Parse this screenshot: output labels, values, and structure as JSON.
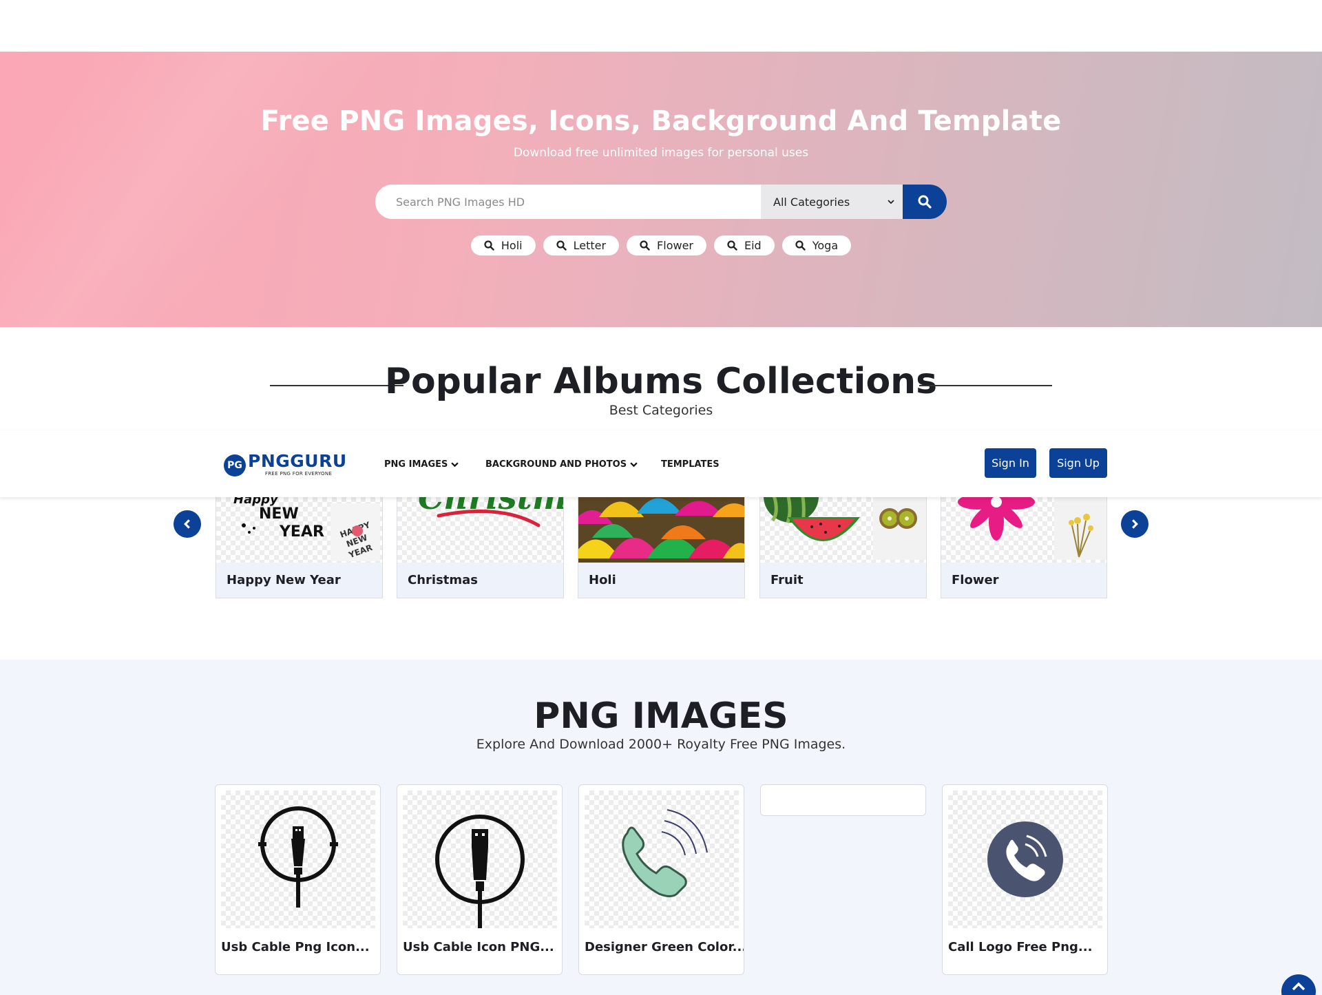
{
  "hero": {
    "title": "Free PNG Images, Icons, Background And Template",
    "subtitle": "Download free unlimited images for personal uses",
    "search_placeholder": "Search PNG Images HD",
    "category_selected": "All Categories",
    "tags": [
      "Holi",
      "Letter",
      "Flower",
      "Eid",
      "Yoga"
    ]
  },
  "albums": {
    "title": "Popular Albums Collections",
    "subtitle": "Best Categories",
    "items": [
      "Happy New Year",
      "Christmas",
      "Holi",
      "Fruit",
      "Flower"
    ]
  },
  "nav": {
    "logo_text": "PNGGURU",
    "logo_mark": "PG",
    "logo_tagline": "FREE PNG FOR EVERYONE",
    "items": [
      "PNG IMAGES",
      "BACKGROUND AND PHOTOS",
      "TEMPLATES"
    ],
    "sign_in": "Sign In",
    "sign_up": "Sign Up"
  },
  "png_section": {
    "title": "PNG IMAGES",
    "subtitle": "Explore And Download 2000+ Royalty Free PNG Images.",
    "cards": [
      "Usb Cable Png Icon...",
      "Usb Cable Icon PNG...",
      "Designer Green Color...",
      "",
      "Call Logo Free Png..."
    ]
  },
  "colors": {
    "brand_blue": "#0b4197",
    "card_label_bg": "#eef2fb",
    "section_bg": "#f2f6fc"
  },
  "icons": [
    "search-icon",
    "chevron-down-icon",
    "chevron-left-icon",
    "chevron-right-icon",
    "chevron-up-icon"
  ]
}
